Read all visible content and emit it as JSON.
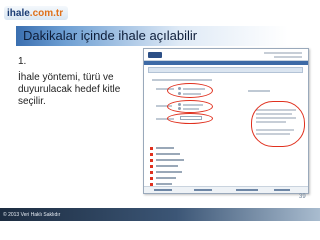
{
  "logo": {
    "part1": "ihale",
    "part2": ".com.tr"
  },
  "slide": {
    "title": "Dakikalar içinde ihale açılabilir",
    "step_number": "1.",
    "description": "İhale yöntemi, türü ve duyurulacak hedef kitle seçilir."
  },
  "page_number": "39",
  "footer": {
    "copyright": "© 2013 Veri Haklı Saklıdır"
  },
  "colors": {
    "accent_red": "#e0301e",
    "title_bar_blue": "#3a6fb0",
    "footer_dark": "#1c2c40"
  }
}
